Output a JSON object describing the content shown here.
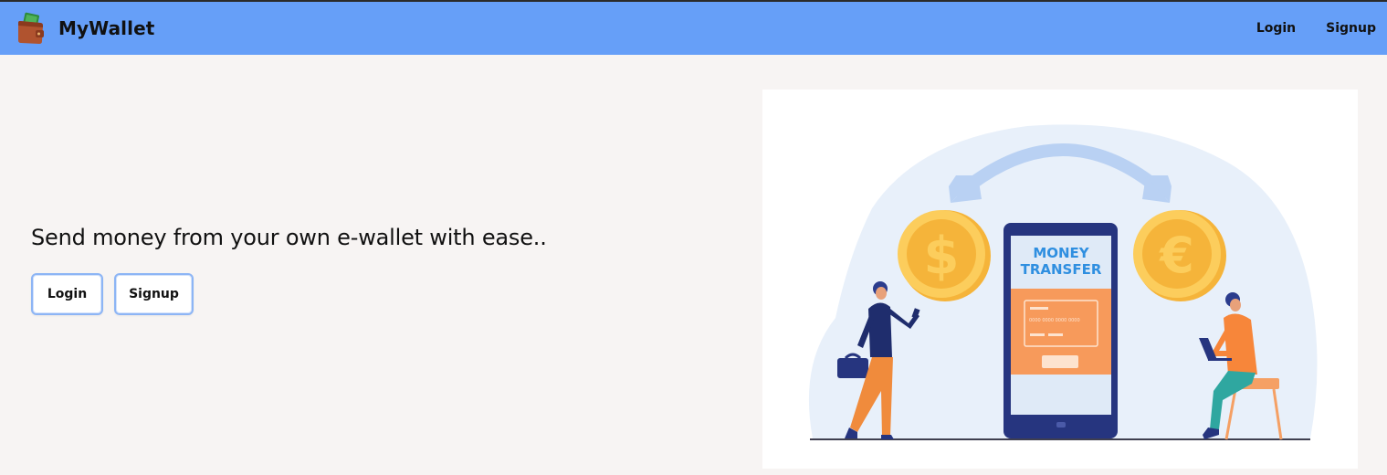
{
  "navbar": {
    "brand_name": "MyWallet",
    "brand_icon": "wallet-icon",
    "login_label": "Login",
    "signup_label": "Signup",
    "background_color": "#669ff8"
  },
  "hero": {
    "tagline": "Send money from your own e-wallet with ease..",
    "login_button": "Login",
    "signup_button": "Signup"
  },
  "illustration": {
    "screen_title_line1": "MONEY",
    "screen_title_line2": "TRANSFER",
    "card_number": "0000 0000 0000 0000",
    "coin_left_symbol": "$",
    "coin_right_symbol": "€"
  }
}
